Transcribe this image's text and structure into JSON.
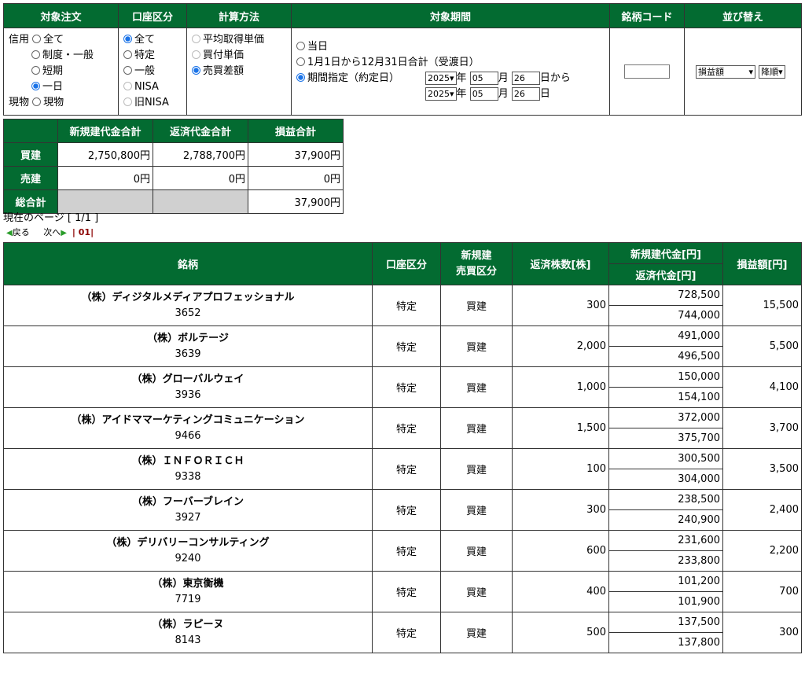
{
  "filters": {
    "headers": [
      "対象注文",
      "口座区分",
      "計算方法",
      "対象期間",
      "銘柄コード",
      "並び替え"
    ],
    "order": {
      "credit_label": "信用",
      "credit_options": [
        {
          "label": "全て",
          "selected": false
        },
        {
          "label": "制度・一般",
          "selected": false
        },
        {
          "label": "短期",
          "selected": false
        },
        {
          "label": "一日",
          "selected": true
        }
      ],
      "spot_label": "現物",
      "spot_option": {
        "label": "現物",
        "selected": false
      }
    },
    "account": [
      {
        "label": "全て",
        "selected": true
      },
      {
        "label": "特定",
        "selected": false
      },
      {
        "label": "一般",
        "selected": false
      },
      {
        "label": "NISA",
        "selected": false,
        "disabled": true
      },
      {
        "label": "旧NISA",
        "selected": false,
        "disabled": true
      }
    ],
    "calc": [
      {
        "label": "平均取得単価",
        "selected": false
      },
      {
        "label": "買付単価",
        "selected": false
      },
      {
        "label": "売買差額",
        "selected": true
      }
    ],
    "period": {
      "today": "当日",
      "yearly": "1月1日から12月31日合計（受渡日）",
      "range": "期間指定（約定日）",
      "from": {
        "year": "2025",
        "month": "05",
        "day": "26",
        "suffix": "日から"
      },
      "to": {
        "year": "2025",
        "month": "05",
        "day": "26",
        "suffix": "日"
      },
      "year_label": "年",
      "month_label": "月"
    },
    "code_value": "",
    "sort": {
      "field": "損益額",
      "order": "降順"
    }
  },
  "summary": {
    "headers": [
      "新規建代金合計",
      "返済代金合計",
      "損益合計"
    ],
    "rows": [
      {
        "label": "買建",
        "new": "2,750,800円",
        "repay": "2,788,700円",
        "pl": "37,900円"
      },
      {
        "label": "売建",
        "new": "0円",
        "repay": "0円",
        "pl": "0円"
      }
    ],
    "total_label": "総合計",
    "total_pl": "37,900円"
  },
  "pagination": {
    "current_page": "現在のページ [ 1/1 ]",
    "prev": "戻る",
    "next": "次へ",
    "page": "01"
  },
  "table": {
    "headers": {
      "name": "銘柄",
      "account": "口座区分",
      "new_type_1": "新規建",
      "new_type_2": "売買区分",
      "qty": "返済株数[株]",
      "new_amt": "新規建代金[円]",
      "repay_amt": "返済代金[円]",
      "pl": "損益額[円]"
    },
    "rows": [
      {
        "name": "（株）ディジタルメディアプロフェッショナル",
        "code": "3652",
        "account": "特定",
        "type": "買建",
        "qty": "300",
        "new_amt": "728,500",
        "repay_amt": "744,000",
        "pl": "15,500"
      },
      {
        "name": "（株）ボルテージ",
        "code": "3639",
        "account": "特定",
        "type": "買建",
        "qty": "2,000",
        "new_amt": "491,000",
        "repay_amt": "496,500",
        "pl": "5,500"
      },
      {
        "name": "（株）グローバルウェイ",
        "code": "3936",
        "account": "特定",
        "type": "買建",
        "qty": "1,000",
        "new_amt": "150,000",
        "repay_amt": "154,100",
        "pl": "4,100"
      },
      {
        "name": "（株）アイドママーケティングコミュニケーション",
        "code": "9466",
        "account": "特定",
        "type": "買建",
        "qty": "1,500",
        "new_amt": "372,000",
        "repay_amt": "375,700",
        "pl": "3,700"
      },
      {
        "name": "（株）ＩＮＦＯＲＩＣＨ",
        "code": "9338",
        "account": "特定",
        "type": "買建",
        "qty": "100",
        "new_amt": "300,500",
        "repay_amt": "304,000",
        "pl": "3,500"
      },
      {
        "name": "（株）フーバーブレイン",
        "code": "3927",
        "account": "特定",
        "type": "買建",
        "qty": "300",
        "new_amt": "238,500",
        "repay_amt": "240,900",
        "pl": "2,400"
      },
      {
        "name": "（株）デリバリーコンサルティング",
        "code": "9240",
        "account": "特定",
        "type": "買建",
        "qty": "600",
        "new_amt": "231,600",
        "repay_amt": "233,800",
        "pl": "2,200"
      },
      {
        "name": "（株）東京衡機",
        "code": "7719",
        "account": "特定",
        "type": "買建",
        "qty": "400",
        "new_amt": "101,200",
        "repay_amt": "101,900",
        "pl": "700"
      },
      {
        "name": "（株）ラピーヌ",
        "code": "8143",
        "account": "特定",
        "type": "買建",
        "qty": "500",
        "new_amt": "137,500",
        "repay_amt": "137,800",
        "pl": "300"
      }
    ]
  }
}
